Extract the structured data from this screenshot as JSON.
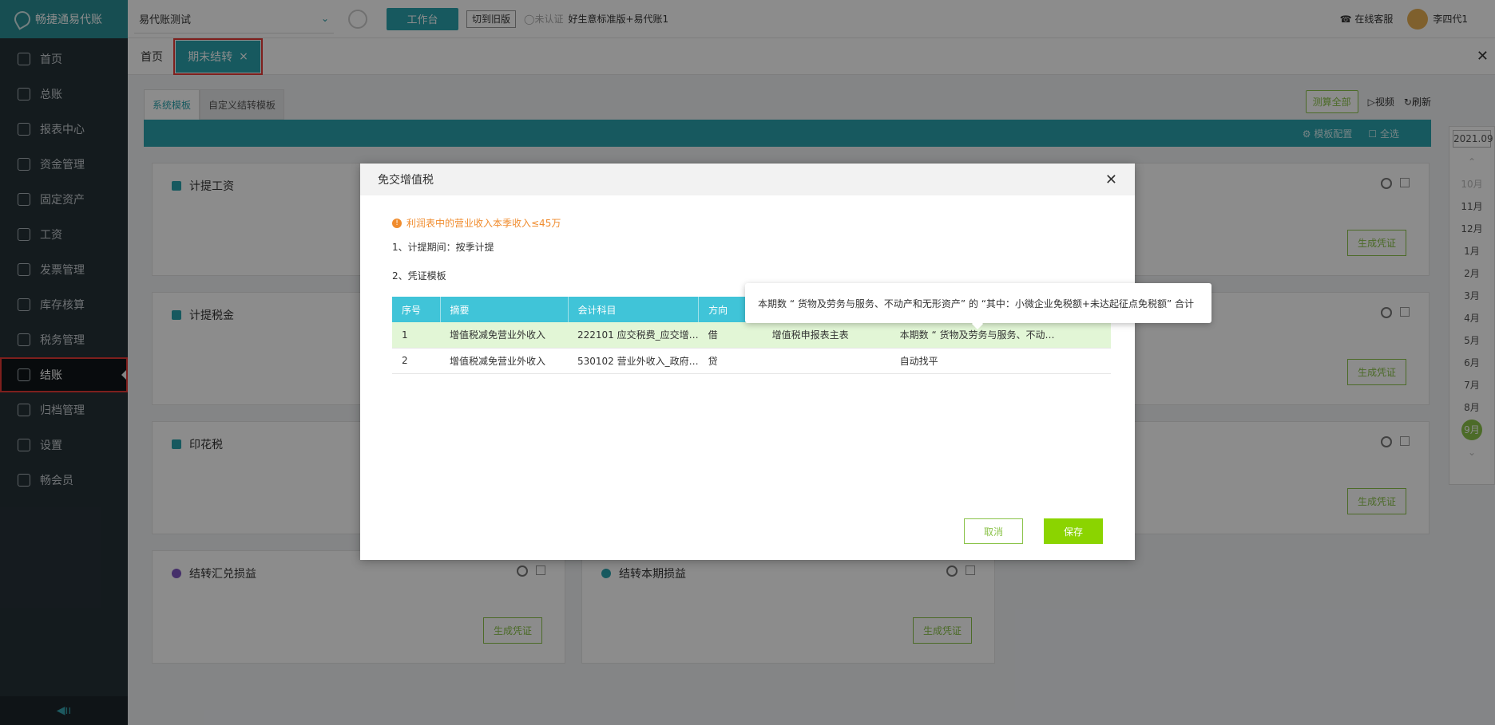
{
  "app": {
    "logo_text": "畅捷通易代账"
  },
  "sidebar": {
    "items": [
      {
        "label": "首页",
        "icon": "home-icon"
      },
      {
        "label": "总账",
        "icon": "ledger-icon"
      },
      {
        "label": "报表中心",
        "icon": "report-icon"
      },
      {
        "label": "资金管理",
        "icon": "fund-icon"
      },
      {
        "label": "固定资产",
        "icon": "asset-icon"
      },
      {
        "label": "工资",
        "icon": "salary-icon"
      },
      {
        "label": "发票管理",
        "icon": "invoice-icon"
      },
      {
        "label": "库存核算",
        "icon": "inventory-icon"
      },
      {
        "label": "税务管理",
        "icon": "tax-icon"
      },
      {
        "label": "结账",
        "icon": "closing-icon"
      },
      {
        "label": "归档管理",
        "icon": "archive-icon"
      },
      {
        "label": "设置",
        "icon": "settings-icon"
      },
      {
        "label": "畅会员",
        "icon": "member-icon"
      }
    ],
    "active_index": 9,
    "collapse_glyph": "◀ıı"
  },
  "topbar": {
    "company": "易代账测试",
    "workbench": "工作台",
    "switch_old": "切到旧版",
    "unauth": "未认证",
    "edition": "好生意标准版+易代账1",
    "service": "在线客服",
    "user": "李四代1"
  },
  "tabs": {
    "home": "首页",
    "active": "期末结转",
    "active_close": "×"
  },
  "subtabs": {
    "system": "系统模板",
    "custom": "自定义结转模板"
  },
  "actions": {
    "calc_all": "测算全部",
    "video": "视频",
    "refresh": "刷新",
    "template_config": "模板配置",
    "select_all": "全选"
  },
  "cards": [
    {
      "title": "计提工资",
      "gen": "生成凭证"
    },
    {
      "title": "计提税金",
      "gen": "生成凭证"
    },
    {
      "title": "印花税",
      "gen": "生成凭证"
    },
    {
      "title": "结转汇兑损益",
      "gen": "生成凭证"
    },
    {
      "title": "结转本期损益",
      "gen": "生成凭证"
    }
  ],
  "date_panel": {
    "year": "2021.09",
    "months_prev": [
      "10月",
      "11月",
      "12月"
    ],
    "year_tag": "2021",
    "months": [
      "1月",
      "2月",
      "3月",
      "4月",
      "5月",
      "6月",
      "7月",
      "8月"
    ],
    "current": "9月"
  },
  "modal": {
    "title": "免交增值税",
    "warning": "利润表中的营业收入本季收入≤45万",
    "period": "1、计提期间：按季计提",
    "template": "2、凭证模板",
    "columns": [
      "序号",
      "摘要",
      "会计科目",
      "方向",
      "",
      ""
    ],
    "rows": [
      [
        "1",
        "增值税减免营业外收入",
        "222101 应交税费_应交增…",
        "借",
        "增值税申报表主表",
        "本期数 “ 货物及劳务与服务、不动…"
      ],
      [
        "2",
        "增值税减免营业外收入",
        "530102 营业外收入_政府…",
        "贷",
        "",
        "自动找平"
      ]
    ],
    "cancel": "取消",
    "save": "保存"
  },
  "tooltip": "本期数 “ 货物及劳务与服务、不动产和无形资产” 的 “其中：小微企业免税额+未达起征点免税额” 合计"
}
